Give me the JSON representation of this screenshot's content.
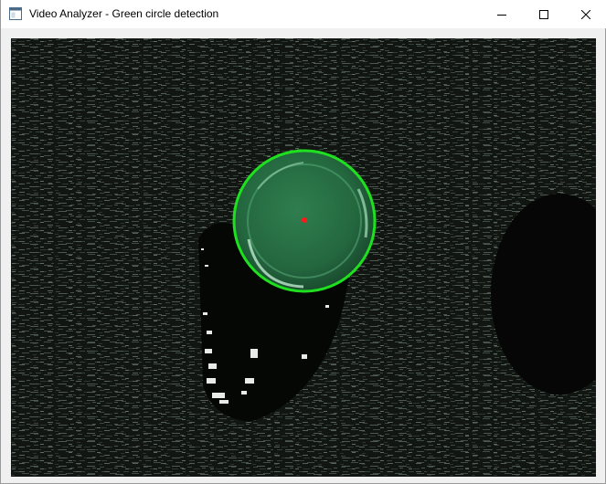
{
  "window": {
    "title": "Video Analyzer - Green circle detection",
    "icon": "app-window-icon",
    "controls": {
      "minimize": "minimize-icon",
      "maximize": "maximize-icon",
      "close": "close-icon"
    }
  },
  "video_frame": {
    "content": "camera frame with detected green circle",
    "detection": {
      "outline_color": "#1fe01f",
      "center_marker_color": "#ff1a1a",
      "fill_color": "#1f6a3a"
    },
    "background_color": "#0d0f0d"
  }
}
